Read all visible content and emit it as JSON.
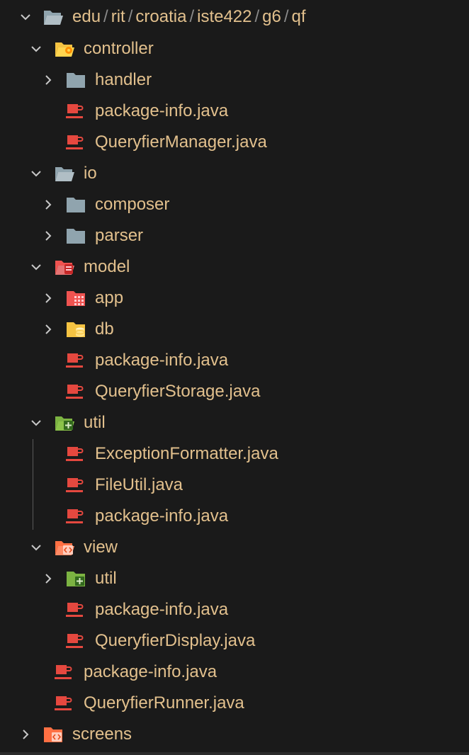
{
  "explorer": {
    "root": {
      "path_segments": [
        "edu",
        "rit",
        "croatia",
        "iste422",
        "g6",
        "qf"
      ],
      "separator": "/",
      "icon": "folder-open-icon"
    },
    "items": [
      {
        "label": "controller",
        "type": "folder",
        "expanded": true,
        "icon": "folder-controller-icon"
      },
      {
        "label": "handler",
        "type": "folder",
        "expanded": false,
        "icon": "folder-icon"
      },
      {
        "label": "package-info.java",
        "type": "file",
        "icon": "java-file-icon"
      },
      {
        "label": "QueryfierManager.java",
        "type": "file",
        "icon": "java-file-icon"
      },
      {
        "label": "io",
        "type": "folder",
        "expanded": true,
        "icon": "folder-open-icon"
      },
      {
        "label": "composer",
        "type": "folder",
        "expanded": false,
        "icon": "folder-icon"
      },
      {
        "label": "parser",
        "type": "folder",
        "expanded": false,
        "icon": "folder-icon"
      },
      {
        "label": "model",
        "type": "folder",
        "expanded": true,
        "icon": "folder-model-icon"
      },
      {
        "label": "app",
        "type": "folder",
        "expanded": false,
        "icon": "folder-app-icon"
      },
      {
        "label": "db",
        "type": "folder",
        "expanded": false,
        "icon": "folder-database-icon"
      },
      {
        "label": "package-info.java",
        "type": "file",
        "icon": "java-file-icon"
      },
      {
        "label": "QueryfierStorage.java",
        "type": "file",
        "icon": "java-file-icon"
      },
      {
        "label": "util",
        "type": "folder",
        "expanded": true,
        "icon": "folder-util-icon"
      },
      {
        "label": "ExceptionFormatter.java",
        "type": "file",
        "icon": "java-file-icon"
      },
      {
        "label": "FileUtil.java",
        "type": "file",
        "icon": "java-file-icon"
      },
      {
        "label": "package-info.java",
        "type": "file",
        "icon": "java-file-icon"
      },
      {
        "label": "view",
        "type": "folder",
        "expanded": true,
        "icon": "folder-view-icon"
      },
      {
        "label": "util",
        "type": "folder",
        "expanded": false,
        "icon": "folder-util-icon"
      },
      {
        "label": "package-info.java",
        "type": "file",
        "icon": "java-file-icon"
      },
      {
        "label": "QueryfierDisplay.java",
        "type": "file",
        "icon": "java-file-icon"
      },
      {
        "label": "package-info.java",
        "type": "file",
        "icon": "java-file-icon"
      },
      {
        "label": "QueryfierRunner.java",
        "type": "file",
        "icon": "java-file-icon"
      },
      {
        "label": "screens",
        "type": "folder",
        "expanded": false,
        "icon": "folder-view-icon"
      }
    ]
  },
  "colors": {
    "background": "#1a1a1a",
    "label": "#e2c08d",
    "separator": "#8a8a8a",
    "chevron": "#c8c8c8",
    "java_icon": "#e5483f",
    "folder_gray": "#90a4ae",
    "folder_yellow": "#f5c342",
    "folder_red": "#ef5350",
    "folder_green": "#8bc34a",
    "folder_orange": "#ff8a65"
  }
}
